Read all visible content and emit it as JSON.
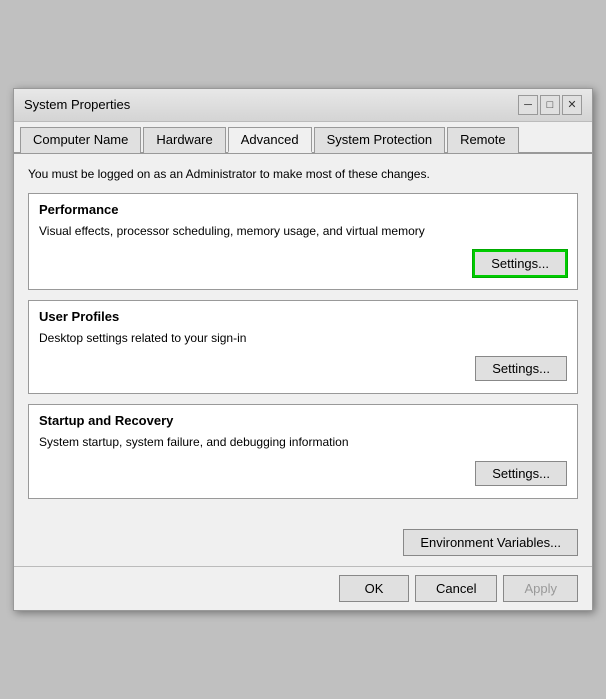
{
  "window": {
    "title": "System Properties",
    "close_btn": "✕"
  },
  "tabs": [
    {
      "id": "computer-name",
      "label": "Computer Name",
      "active": false
    },
    {
      "id": "hardware",
      "label": "Hardware",
      "active": false
    },
    {
      "id": "advanced",
      "label": "Advanced",
      "active": true
    },
    {
      "id": "system-protection",
      "label": "System Protection",
      "active": false
    },
    {
      "id": "remote",
      "label": "Remote",
      "active": false
    }
  ],
  "admin_notice": "You must be logged on as an Administrator to make most of these changes.",
  "sections": {
    "performance": {
      "title": "Performance",
      "desc": "Visual effects, processor scheduling, memory usage, and virtual memory",
      "settings_label": "Settings...",
      "highlighted": true
    },
    "user_profiles": {
      "title": "User Profiles",
      "desc": "Desktop settings related to your sign-in",
      "settings_label": "Settings...",
      "highlighted": false
    },
    "startup_recovery": {
      "title": "Startup and Recovery",
      "desc": "System startup, system failure, and debugging information",
      "settings_label": "Settings...",
      "highlighted": false
    }
  },
  "env_btn_label": "Environment Variables...",
  "dialog": {
    "ok_label": "OK",
    "cancel_label": "Cancel",
    "apply_label": "Apply"
  }
}
